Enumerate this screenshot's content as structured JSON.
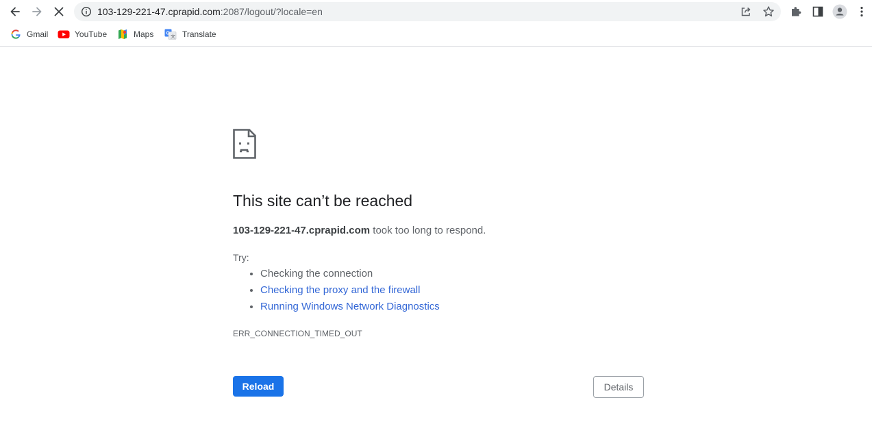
{
  "browser": {
    "url_host": "103-129-221-47.cprapid.com",
    "url_rest": ":2087/logout/?locale=en",
    "icons": {
      "back": "back-arrow-icon",
      "forward": "forward-arrow-icon",
      "stop": "stop-loading-icon",
      "info": "site-info-icon",
      "share": "share-icon",
      "star": "bookmark-star-icon",
      "extensions": "extensions-puzzle-icon",
      "side_panel": "side-panel-icon",
      "profile": "profile-avatar-icon",
      "menu": "kebab-menu-icon"
    }
  },
  "bookmarks": [
    {
      "label": "Gmail",
      "icon": "google-icon"
    },
    {
      "label": "YouTube",
      "icon": "youtube-icon"
    },
    {
      "label": "Maps",
      "icon": "maps-icon"
    },
    {
      "label": "Translate",
      "icon": "translate-icon"
    }
  ],
  "error_page": {
    "icon": "sad-page-icon",
    "title": "This site can’t be reached",
    "host": "103-129-221-47.cprapid.com",
    "summary_rest": " took too long to respond.",
    "try_label": "Try:",
    "suggestions": [
      {
        "text": "Checking the connection",
        "is_link": false
      },
      {
        "text": "Checking the proxy and the firewall",
        "is_link": true
      },
      {
        "text": "Running Windows Network Diagnostics",
        "is_link": true
      }
    ],
    "error_code": "ERR_CONNECTION_TIMED_OUT",
    "reload_label": "Reload",
    "details_label": "Details"
  },
  "colors": {
    "accent": "#1a73e8",
    "link": "#3367d6",
    "text_secondary": "#5f6368"
  }
}
